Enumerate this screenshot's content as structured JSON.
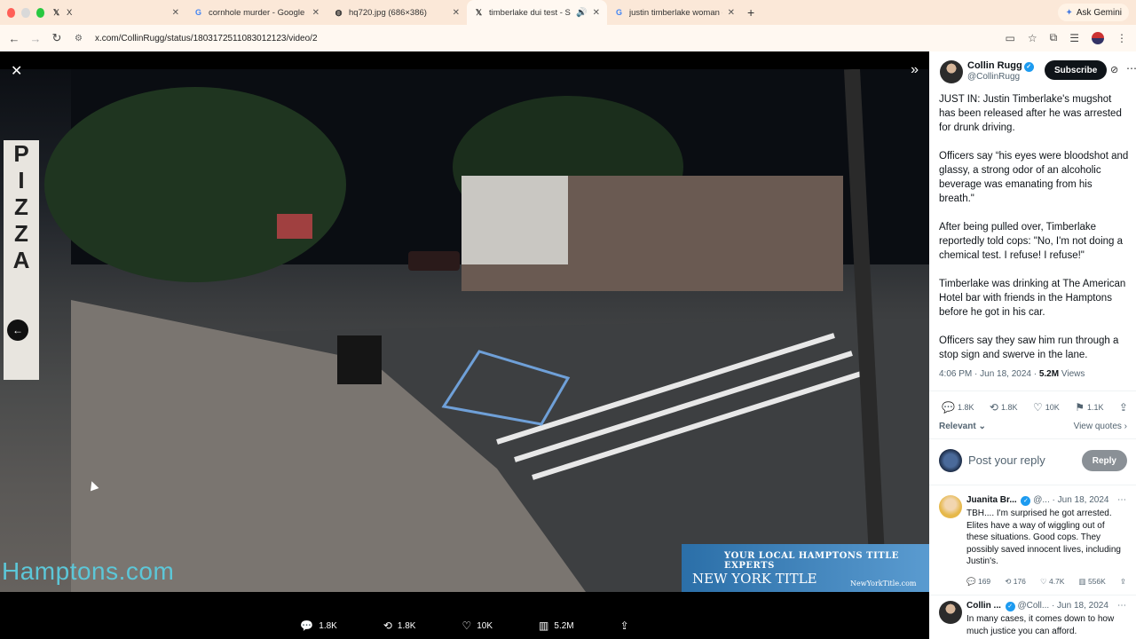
{
  "browser": {
    "tabs": [
      {
        "title": "X",
        "icon": "x-logo-icon"
      },
      {
        "title": "cornhole murder - Google Se",
        "icon": "google-icon"
      },
      {
        "title": "hq720.jpg (686×386)",
        "icon": "globe-icon"
      },
      {
        "title": "timberlake dui test - Sear",
        "icon": "x-logo-icon",
        "active": true
      },
      {
        "title": "justin timberlake woman dui",
        "icon": "google-icon"
      }
    ],
    "gemini_label": "Ask Gemini",
    "url": "x.com/CollinRugg/status/1803172511083012123/video/2"
  },
  "video": {
    "sign_text": "PIZZA",
    "watermark": "Hamptons.com",
    "banner_line1": "YOUR LOCAL HAMPTONS TITLE EXPERTS",
    "banner_line2": "NEW YORK TITLE",
    "banner_line3": "NewYorkTitle.com"
  },
  "stats_bar": {
    "replies": "1.8K",
    "reposts": "1.8K",
    "likes": "10K",
    "views": "5.2M"
  },
  "post": {
    "author_name": "Collin Rugg",
    "author_handle": "@CollinRugg",
    "subscribe_label": "Subscribe",
    "paragraphs": [
      "JUST IN: Justin Timberlake's mugshot has been released after he was arrested for drunk driving.",
      "Officers say “his eyes were bloodshot and glassy, a strong odor of an alcoholic beverage was emanating from his breath.\"",
      "After being pulled over, Timberlake reportedly told cops: \"No, I'm not doing a chemical test. I refuse! I refuse!\"",
      "Timberlake was drinking at The American Hotel bar with friends in the Hamptons before he got in his car.",
      "Officers say they saw him run through a stop sign and swerve in the lane."
    ],
    "time": "4:06 PM · Jun 18, 2024 · ",
    "views_count": "5.2M",
    "views_label": " Views",
    "replies": "1.8K",
    "reposts": "1.8K",
    "likes": "10K",
    "bookmarks": "1.1K",
    "sort_label": "Relevant",
    "view_quotes": "View quotes"
  },
  "reply_box": {
    "placeholder": "Post your reply",
    "button": "Reply"
  },
  "replies": [
    {
      "name": "Juanita Br...",
      "handle": "@...",
      "date": "· Jun 18, 2024",
      "text": "TBH.... I'm surprised he got arrested. Elites have a way of wiggling out of these situations.   Good cops.  They possibly saved innocent lives, including Justin's.",
      "replies": "169",
      "reposts": "176",
      "likes": "4.7K",
      "views": "556K"
    },
    {
      "name": "Collin ...",
      "handle": "@Coll...",
      "date": "· Jun 18, 2024",
      "text": "In many cases, it comes down to how much justice you can afford."
    }
  ]
}
